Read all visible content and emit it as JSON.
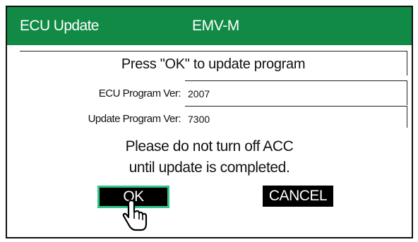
{
  "header": {
    "title": "ECU Update",
    "model": "EMV-M",
    "background_color": "#118a45"
  },
  "prompt": {
    "message": "Press \"OK\" to update program"
  },
  "versions": {
    "ecu_label": "ECU Program Ver:",
    "ecu_value": "2007",
    "update_label": "Update Program Ver:",
    "update_value": "7300"
  },
  "warning": {
    "line1": "Please do not turn off ACC",
    "line2": "until update is completed."
  },
  "buttons": {
    "ok_label": "OK",
    "cancel_label": "CANCEL",
    "ok_highlight_color": "#34c48a"
  },
  "cursor": {
    "icon": "pointing-hand-icon"
  }
}
